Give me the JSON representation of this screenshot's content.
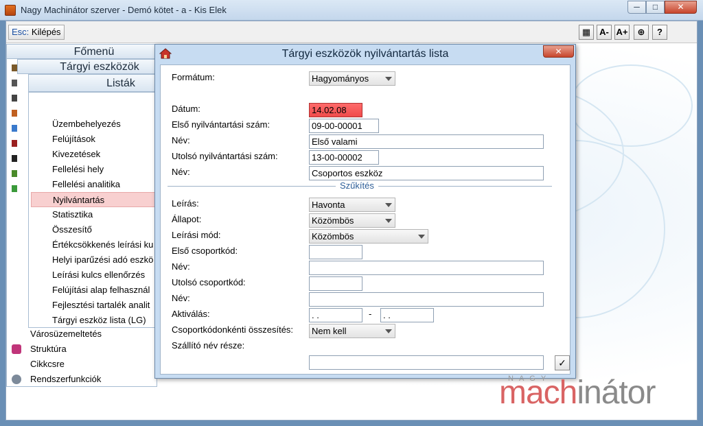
{
  "window": {
    "title": "Nagy Machinátor szerver - Demó kötet - a - Kis Elek",
    "min_label": "─",
    "max_label": "□",
    "close_label": "✕"
  },
  "toolbar": {
    "esc_key": "Esc:",
    "esc_label": "Kilépés",
    "icons": [
      "grid-icon",
      "font-decrease-icon",
      "font-increase-icon",
      "navigate-icon",
      "help-icon"
    ],
    "icon_glyphs": [
      "▦",
      "A-",
      "A+",
      "⊕",
      "?"
    ]
  },
  "menu": {
    "main_title": "Főmenü",
    "sub_title": "Tárgyi eszközök",
    "list_title": "Listák",
    "list_items": [
      "Üzembehelyezés",
      "Felújítások",
      "Kivezetések",
      "Fellelési hely",
      "Fellelési analitika",
      "Nyilvántartás",
      "Statisztika",
      "Összesítő",
      "Értékcsökkenés leírási ku",
      "Helyi iparűzési adó eszkö",
      "Leírási kulcs ellenőrzés",
      "Felújítási alap felhasznál",
      "Fejlesztési tartalék analit",
      "Tárgyi eszköz lista (LG)"
    ],
    "selected_index": 5,
    "bottom_items": [
      "Városüzemeltetés",
      "Struktúra",
      "Cikkcsre",
      "Rendszerfunkciók"
    ]
  },
  "dialog": {
    "title": "Tárgyi eszközök nyilvántartás lista",
    "close_label": "✕",
    "format_label": "Formátum:",
    "format_value": "Hagyományos",
    "date_label": "Dátum:",
    "date_value": "14.02.08",
    "first_num_label": "Első nyilvántartási szám:",
    "first_num_value": "09-00-00001",
    "name1_label": "Név:",
    "name1_value": "Első valami",
    "last_num_label": "Utolsó nyilvántartási szám:",
    "last_num_value": "13-00-00002",
    "name2_label": "Név:",
    "name2_value": "Csoportos eszköz",
    "section_title": "Szűkítés",
    "description_label": "Leírás:",
    "description_value": "Havonta",
    "state_label": "Állapot:",
    "state_value": "Közömbös",
    "method_label": "Leírási mód:",
    "method_value": "Közömbös",
    "first_group_label": "Első csoportkód:",
    "first_group_value": "",
    "name3_label": "Név:",
    "name3_value": "",
    "last_group_label": "Utolsó csoportkód:",
    "last_group_value": "",
    "name4_label": "Név:",
    "name4_value": "",
    "activation_label": "Aktiválás:",
    "activation_from": " .  .",
    "activation_dash": "-",
    "activation_to": " .  .",
    "group_sum_label": "Csoportkódonkénti összesítés:",
    "group_sum_value": "Nem kell",
    "supplier_label": "Szállító név része:",
    "supplier_value": "",
    "ok_label": "✓"
  },
  "logo": {
    "top": "NAGY",
    "part1": "mach",
    "part2": "inátor"
  }
}
